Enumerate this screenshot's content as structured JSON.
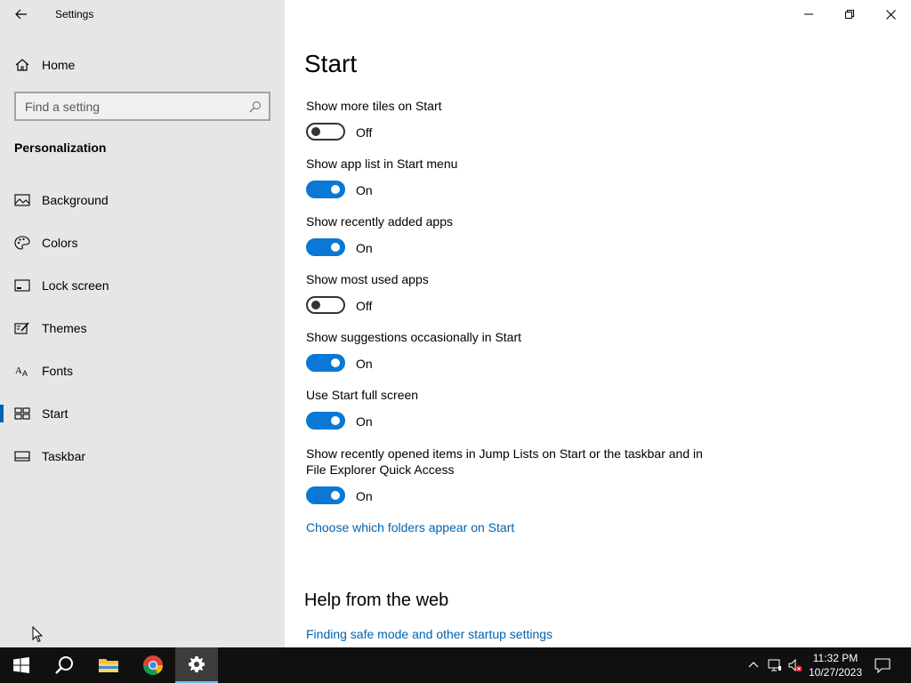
{
  "window": {
    "app_title": "Settings"
  },
  "sidebar": {
    "home_label": "Home",
    "search_placeholder": "Find a setting",
    "section_title": "Personalization",
    "items": [
      {
        "label": "Background",
        "icon": "image-icon"
      },
      {
        "label": "Colors",
        "icon": "palette-icon"
      },
      {
        "label": "Lock screen",
        "icon": "lock-screen-icon"
      },
      {
        "label": "Themes",
        "icon": "themes-icon"
      },
      {
        "label": "Fonts",
        "icon": "fonts-icon"
      },
      {
        "label": "Start",
        "icon": "start-icon",
        "selected": true
      },
      {
        "label": "Taskbar",
        "icon": "taskbar-icon"
      }
    ]
  },
  "main": {
    "title": "Start",
    "settings": [
      {
        "label": "Show more tiles on Start",
        "state": "Off",
        "on": false
      },
      {
        "label": "Show app list in Start menu",
        "state": "On",
        "on": true
      },
      {
        "label": "Show recently added apps",
        "state": "On",
        "on": true
      },
      {
        "label": "Show most used apps",
        "state": "Off",
        "on": false
      },
      {
        "label": "Show suggestions occasionally in Start",
        "state": "On",
        "on": true
      },
      {
        "label": "Use Start full screen",
        "state": "On",
        "on": true
      },
      {
        "label_line1": "Show recently opened items in Jump Lists on Start or the taskbar and in",
        "label_line2": "File Explorer Quick Access",
        "state": "On",
        "on": true
      }
    ],
    "folders_link": "Choose which folders appear on Start",
    "help_title": "Help from the web",
    "help_link": "Finding safe mode and other startup settings"
  },
  "taskbar": {
    "time": "11:32 PM",
    "date": "10/27/2023"
  },
  "colors": {
    "accent": "#0a78d4",
    "link": "#0063b1",
    "sidebar_bg": "#e6e6e6",
    "taskbar_bg": "#101010"
  }
}
